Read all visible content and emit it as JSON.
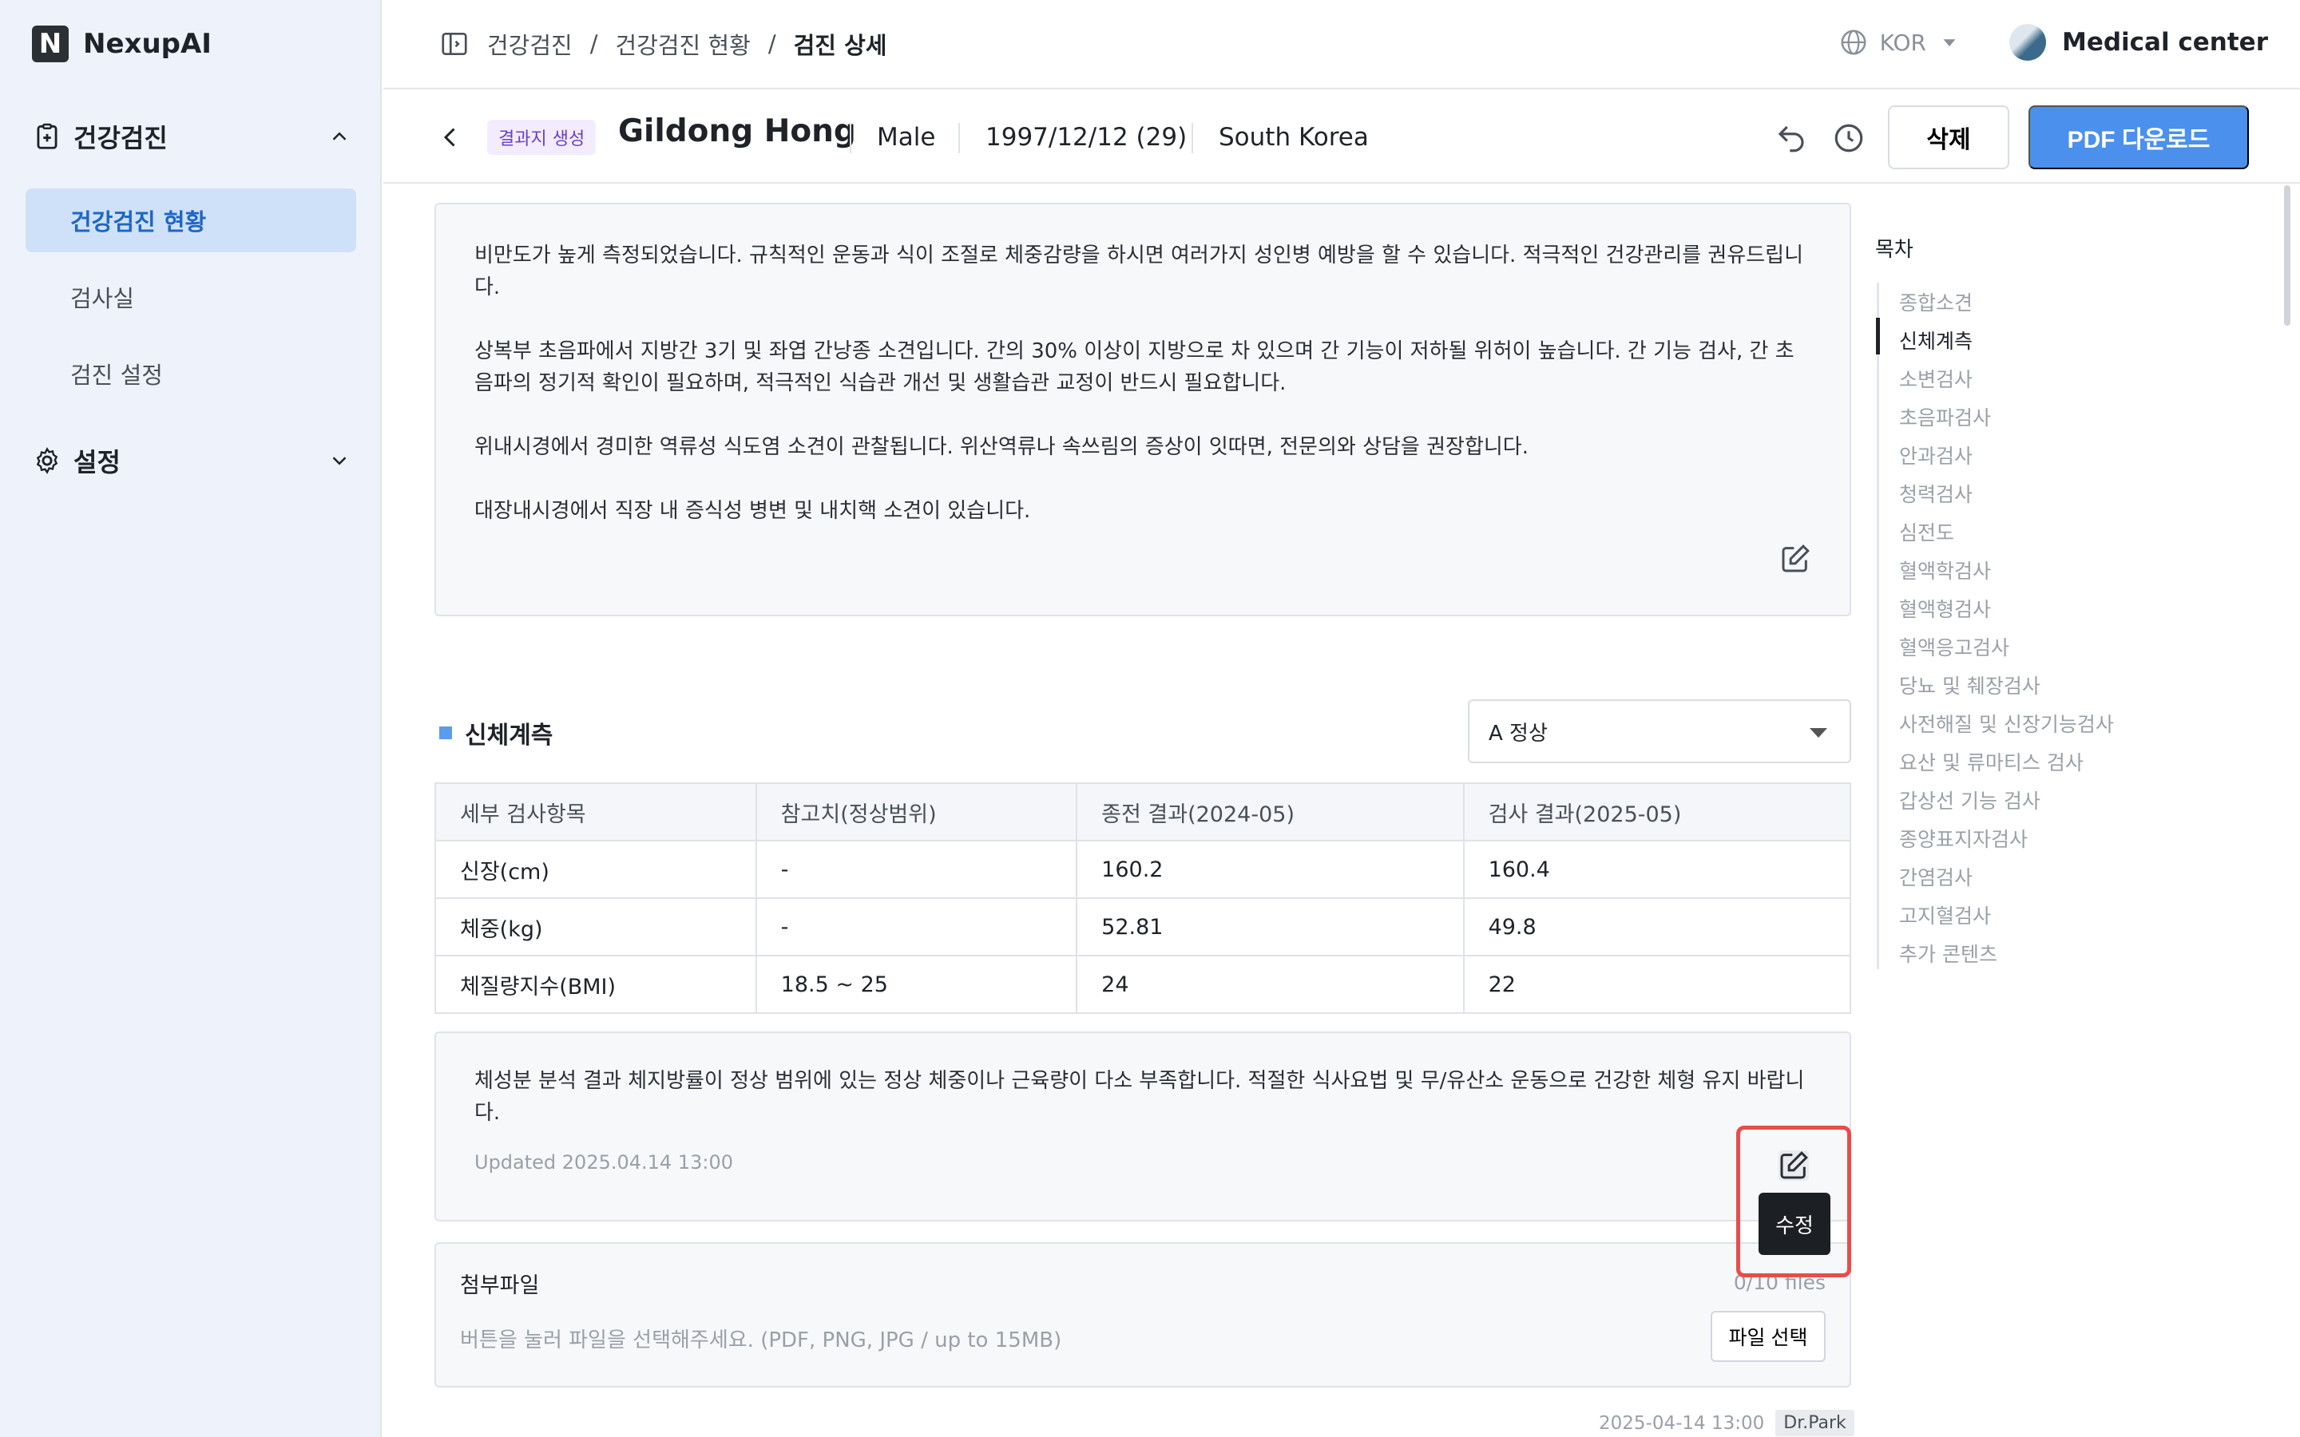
{
  "app": {
    "logo_letter": "N",
    "name": "NexupAI"
  },
  "sidebar": {
    "groups": [
      {
        "label": "건강검진",
        "expanded": true,
        "items": [
          {
            "label": "건강검진 현황",
            "active": true
          },
          {
            "label": "검사실",
            "active": false
          },
          {
            "label": "검진 설정",
            "active": false
          }
        ]
      },
      {
        "label": "설정",
        "expanded": false
      }
    ]
  },
  "topbar": {
    "breadcrumb": [
      "건강검진",
      "건강검진 현황",
      "검진 상세"
    ],
    "breadcrumb_sep": "/",
    "language": "KOR",
    "center_name": "Medical center"
  },
  "patient": {
    "status_badge": "결과지 생성",
    "name": "Gildong Hong",
    "sex": "Male",
    "birth": "1997/12/12 (29)",
    "country": "South Korea",
    "delete_label": "삭제",
    "pdf_label": "PDF 다운로드"
  },
  "summary": {
    "paragraphs": [
      "비만도가 높게 측정되었습니다. 규칙적인 운동과 식이 조절로 체중감량을 하시면 여러가지 성인병 예방을 할 수 있습니다. 적극적인 건강관리를 권유드립니다.",
      "상복부 초음파에서 지방간 3기 및 좌엽 간낭종 소견입니다. 간의 30% 이상이 지방으로 차 있으며 간 기능이 저하될 위허이 높습니다. 간 기능 검사, 간 초음파의 정기적 확인이 필요하며, 적극적인 식습관 개선 및 생활습관 교정이 반드시 필요합니다.",
      "위내시경에서 경미한 역류성 식도염 소견이 관찰됩니다. 위산역류나 속쓰림의 증상이 잇따면, 전문의와 상담을 권장합니다.",
      "대장내시경에서 직장 내 증식성 병변 및 내치핵 소견이 있습니다."
    ]
  },
  "body_section": {
    "title": "신체계측",
    "grade": "A 정상",
    "columns": [
      "세부 검사항목",
      "참고치(정상범위)",
      "종전 결과(2024-05)",
      "검사 결과(2025-05)"
    ],
    "rows": [
      [
        "신장(cm)",
        "-",
        "160.2",
        "160.4"
      ],
      [
        "체중(kg)",
        "-",
        "52.81",
        "49.8"
      ],
      [
        "체질량지수(BMI)",
        "18.5 ~ 25",
        "24",
        "22"
      ]
    ],
    "comment": "체성분 분석 결과 체지방률이 정상 범위에 있는 정상 체중이나 근육량이 다소 부족합니다. 적절한 식사요법 및 무/유산소 운동으로 건강한 체형 유지 바랍니다.",
    "updated": "Updated 2025.04.14 13:00",
    "edit_tooltip": "수정"
  },
  "attachments": {
    "title": "첨부파일",
    "count": "0/10 files",
    "hint": "버튼을 눌러 파일을 선택해주세요. (PDF, PNG, JPG / up to 15MB)",
    "button": "파일 선택"
  },
  "footer": {
    "timestamp": "2025-04-14 13:00",
    "doctor": "Dr.Park"
  },
  "toc": {
    "title": "목차",
    "items": [
      "종합소견",
      "신체계측",
      "소변검사",
      "초음파검사",
      "안과검사",
      "청력검사",
      "심전도",
      "혈액학검사",
      "혈액형검사",
      "혈액응고검사",
      "당뇨 및 췌장검사",
      "사전해질 및 신장기능검사",
      "요산 및 류마티스 검사",
      "갑상선 기능 검사",
      "종양표지자검사",
      "간염검사",
      "고지혈검사",
      "추가 콘텐츠"
    ],
    "active_index": 1
  },
  "colors": {
    "accent": "#4a90ec",
    "sidebar_bg": "#eef3fb",
    "active_nav": "#cfe1f8",
    "highlight": "#ea4c4c"
  }
}
